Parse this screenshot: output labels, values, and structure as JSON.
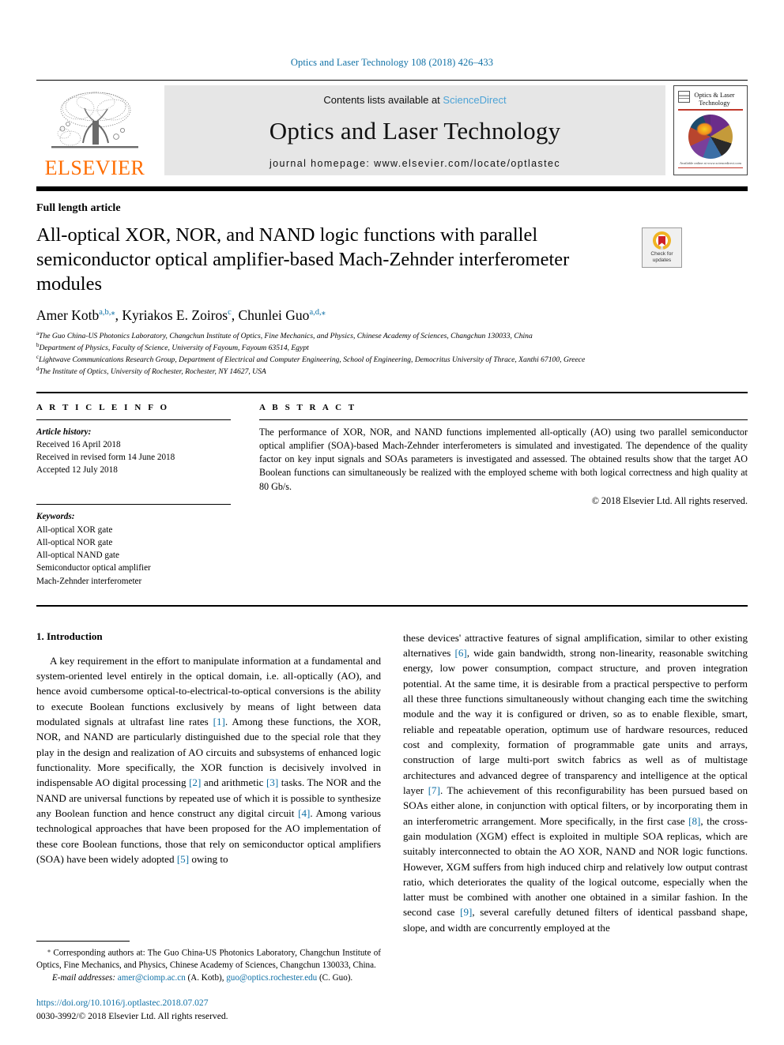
{
  "running_head": "Optics and Laser Technology 108 (2018) 426–433",
  "masthead": {
    "publisher_name": "ELSEVIER",
    "contents_prefix": "Contents lists available at ",
    "contents_link": "ScienceDirect",
    "journal_name": "Optics and Laser Technology",
    "homepage": "journal homepage: www.elsevier.com/locate/optlastec",
    "cover_title": "Optics & Laser Technology",
    "cover_footer": "Available online at www.sciencedirect.com"
  },
  "article": {
    "type": "Full length article",
    "title": "All-optical XOR, NOR, and NAND logic functions with parallel semiconductor optical amplifier-based Mach-Zehnder interferometer modules",
    "crossmark_label_line1": "Check for",
    "crossmark_label_line2": "updates"
  },
  "authors": {
    "list": [
      {
        "name": "Amer Kotb",
        "marks": "a,b,⁎"
      },
      {
        "name": "Kyriakos E. Zoiros",
        "marks": "c"
      },
      {
        "name": "Chunlei Guo",
        "marks": "a,d,⁎"
      }
    ],
    "affiliations": [
      {
        "mark": "a",
        "text": "The Guo China-US Photonics Laboratory, Changchun Institute of Optics, Fine Mechanics, and Physics, Chinese Academy of Sciences, Changchun 130033, China"
      },
      {
        "mark": "b",
        "text": "Department of Physics, Faculty of Science, University of Fayoum, Fayoum 63514, Egypt"
      },
      {
        "mark": "c",
        "text": "Lightwave Communications Research Group, Department of Electrical and Computer Engineering, School of Engineering, Democritus University of Thrace, Xanthi 67100, Greece"
      },
      {
        "mark": "d",
        "text": "The Institute of Optics, University of Rochester, Rochester, NY 14627, USA"
      }
    ]
  },
  "article_info": {
    "heading": "A R T I C L E  I N F O",
    "history_label": "Article history:",
    "history": [
      "Received 16 April 2018",
      "Received in revised form 14 June 2018",
      "Accepted 12 July 2018"
    ],
    "keywords_label": "Keywords:",
    "keywords": [
      "All-optical XOR gate",
      "All-optical NOR gate",
      "All-optical NAND gate",
      "Semiconductor optical amplifier",
      "Mach-Zehnder interferometer"
    ]
  },
  "abstract": {
    "heading": "A B S T R A C T",
    "text": "The performance of XOR, NOR, and NAND functions implemented all-optically (AO) using two parallel semiconductor optical amplifier (SOA)-based Mach-Zehnder interferometers is simulated and investigated. The dependence of the quality factor on key input signals and SOAs parameters is investigated and assessed. The obtained results show that the target AO Boolean functions can simultaneously be realized with the employed scheme with both logical correctness and high quality at 80 Gb/s.",
    "copyright": "© 2018 Elsevier Ltd. All rights reserved."
  },
  "body": {
    "section_heading": "1. Introduction",
    "left_para_1a": "A key requirement in the effort to manipulate information at a fundamental and system-oriented level entirely in the optical domain, i.e. all-optically (AO), and hence avoid cumbersome optical-to-electrical-to-optical conversions is the ability to execute Boolean functions exclusively by means of light between data modulated signals at ultrafast line rates ",
    "left_cite_1": "[1]",
    "left_para_1b": ". Among these functions, the XOR, NOR, and NAND are particularly distinguished due to the special role that they play in the design and realization of AO circuits and subsystems of enhanced logic functionality. More specifically, the XOR function is decisively involved in indispensable AO digital processing ",
    "left_cite_2": "[2]",
    "left_para_1c": " and arithmetic ",
    "left_cite_3": "[3]",
    "left_para_1d": " tasks. The NOR and the NAND are universal functions by repeated use of which it is possible to synthesize any Boolean function and hence construct any digital circuit ",
    "left_cite_4": "[4]",
    "left_para_1e": ". Among various technological approaches that have been proposed for the AO implementation of these core Boolean functions, those that rely on semiconductor optical amplifiers (SOA) have been widely adopted ",
    "left_cite_5": "[5]",
    "left_para_1f": " owing to",
    "right_para_1a": "these devices' attractive features of signal amplification, similar to other existing alternatives ",
    "right_cite_6": "[6]",
    "right_para_1b": ", wide gain bandwidth, strong non-linearity, reasonable switching energy, low power consumption, compact structure, and proven integration potential. At the same time, it is desirable from a practical perspective to perform all these three functions simultaneously without changing each time the switching module and the way it is configured or driven, so as to enable flexible, smart, reliable and repeatable operation, optimum use of hardware resources, reduced cost and complexity, formation of programmable gate units and arrays, construction of large multi-port switch fabrics as well as of multistage architectures and advanced degree of transparency and intelligence at the optical layer ",
    "right_cite_7": "[7]",
    "right_para_1c": ". The achievement of this reconfigurability has been pursued based on SOAs either alone, in conjunction with optical filters, or by incorporating them in an interferometric arrangement. More specifically, in the first case ",
    "right_cite_8": "[8]",
    "right_para_1d": ", the cross-gain modulation (XGM) effect is exploited in multiple SOA replicas, which are suitably interconnected to obtain the AO XOR, NAND and NOR logic functions. However, XGM suffers from high induced chirp and relatively low output contrast ratio, which deteriorates the quality of the logical outcome, especially when the latter must be combined with another one obtained in a similar fashion. In the second case ",
    "right_cite_9": "[9]",
    "right_para_1e": ", several carefully detuned filters of identical passband shape, slope, and width are concurrently employed at the"
  },
  "footnotes": {
    "corresponding_marker": "⁎",
    "corresponding_text": " Corresponding authors at: The Guo China-US Photonics Laboratory, Changchun Institute of Optics, Fine Mechanics, and Physics, Chinese Academy of Sciences, Changchun 130033, China.",
    "email_label": "E-mail addresses:",
    "email_1": "amer@ciomp.ac.cn",
    "email_1_owner": " (A. Kotb), ",
    "email_2": "guo@optics.rochester.edu",
    "email_2_owner": " (C. Guo).",
    "doi": "https://doi.org/10.1016/j.optlastec.2018.07.027",
    "issn_line": "0030-3992/© 2018 Elsevier Ltd. All rights reserved."
  },
  "colors": {
    "link_blue": "#1071a6",
    "sciencedirect_blue": "#4da3d6",
    "elsevier_orange": "#ff6c00"
  }
}
